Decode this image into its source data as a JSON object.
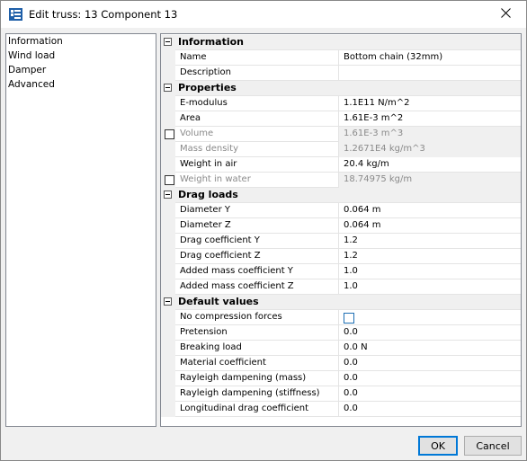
{
  "window": {
    "title": "Edit truss: 13 Component 13",
    "icon": "truss-app-icon",
    "close_icon": "close-icon"
  },
  "nav": {
    "items": [
      "Information",
      "Wind load",
      "Damper",
      "Advanced"
    ]
  },
  "grid": {
    "sections": [
      {
        "label": "Information",
        "rows": [
          {
            "name": "Name",
            "value": "Bottom chain (32mm)"
          },
          {
            "name": "Description",
            "value": ""
          }
        ]
      },
      {
        "label": "Properties",
        "rows": [
          {
            "name": "E-modulus",
            "value": "1.1E11 N/m^2"
          },
          {
            "name": "Area",
            "value": "1.61E-3 m^2"
          },
          {
            "name": "Volume",
            "value": "1.61E-3 m^3",
            "disabled": true,
            "checkbox": true
          },
          {
            "name": "Mass density",
            "value": "1.2671E4 kg/m^3",
            "disabled": true
          },
          {
            "name": "Weight in air",
            "value": "20.4 kg/m"
          },
          {
            "name": "Weight in water",
            "value": "18.74975 kg/m",
            "disabled": true,
            "checkbox": true
          }
        ]
      },
      {
        "label": "Drag loads",
        "rows": [
          {
            "name": "Diameter Y",
            "value": "0.064 m"
          },
          {
            "name": "Diameter Z",
            "value": "0.064 m"
          },
          {
            "name": "Drag coefficient Y",
            "value": "1.2"
          },
          {
            "name": "Drag coefficient Z",
            "value": "1.2"
          },
          {
            "name": "Added mass coefficient Y",
            "value": "1.0"
          },
          {
            "name": "Added mass coefficient Z",
            "value": "1.0"
          }
        ]
      },
      {
        "label": "Default values",
        "rows": [
          {
            "name": "No compression forces",
            "value": "",
            "value_checkbox": true
          },
          {
            "name": "Pretension",
            "value": "0.0"
          },
          {
            "name": "Breaking load",
            "value": "0.0 N"
          },
          {
            "name": "Material coefficient",
            "value": "0.0"
          },
          {
            "name": "Rayleigh dampening (mass)",
            "value": "0.0"
          },
          {
            "name": "Rayleigh dampening (stiffness)",
            "value": "0.0"
          },
          {
            "name": "Longitudinal drag coefficient",
            "value": "0.0"
          }
        ]
      }
    ]
  },
  "buttons": {
    "ok": "OK",
    "cancel": "Cancel"
  }
}
